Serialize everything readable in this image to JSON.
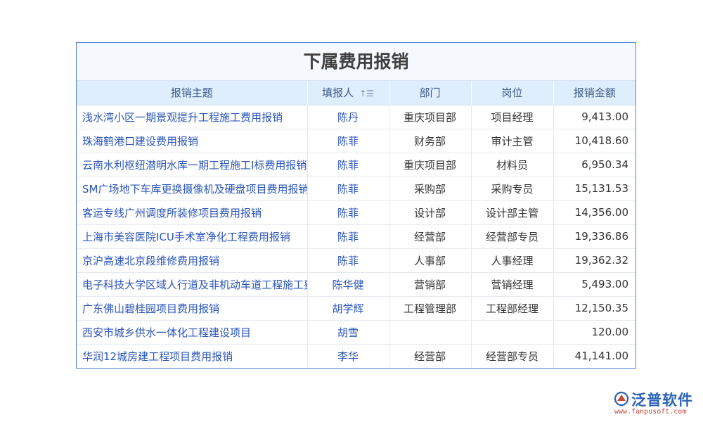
{
  "page_title": "下属费用报销",
  "columns": [
    {
      "label": "报销主题"
    },
    {
      "label": "填报人"
    },
    {
      "label": "部门"
    },
    {
      "label": "岗位"
    },
    {
      "label": "报销金额"
    }
  ],
  "sort_icon": "sort-ascending-icon",
  "rows": [
    {
      "subject": "浅水湾小区一期景观提升工程施工费用报销",
      "person": "陈丹",
      "dept": "重庆项目部",
      "position": "项目经理",
      "amount": "9,413.00"
    },
    {
      "subject": "珠海鹤港口建设费用报销",
      "person": "陈菲",
      "dept": "财务部",
      "position": "审计主管",
      "amount": "10,418.60"
    },
    {
      "subject": "云南水利枢纽潜明水库一期工程施工Ⅰ标费用报销",
      "person": "陈菲",
      "dept": "重庆项目部",
      "position": "材料员",
      "amount": "6,950.34"
    },
    {
      "subject": "SM广场地下车库更换摄像机及硬盘项目费用报销",
      "person": "陈菲",
      "dept": "采购部",
      "position": "采购专员",
      "amount": "15,131.53"
    },
    {
      "subject": "客运专线广州调度所装修项目费用报销",
      "person": "陈菲",
      "dept": "设计部",
      "position": "设计部主管",
      "amount": "14,356.00"
    },
    {
      "subject": "上海市美容医院ICU手术室净化工程费用报销",
      "person": "陈菲",
      "dept": "经营部",
      "position": "经营部专员",
      "amount": "19,336.86"
    },
    {
      "subject": "京沪高速北京段维修费用报销",
      "person": "陈菲",
      "dept": "人事部",
      "position": "人事经理",
      "amount": "19,362.32"
    },
    {
      "subject": "电子科技大学区域人行道及非机动车道工程施工费用报销",
      "person": "陈华健",
      "dept": "营销部",
      "position": "营销经理",
      "amount": "5,493.00"
    },
    {
      "subject": "广东佛山碧桂园项目费用报销",
      "person": "胡学辉",
      "dept": "工程管理部",
      "position": "工程部经理",
      "amount": "12,150.35"
    },
    {
      "subject": "西安市城乡供水一体化工程建设项目",
      "person": "胡雪",
      "dept": "",
      "position": "",
      "amount": "120.00"
    },
    {
      "subject": "华润12城房建工程项目费用报销",
      "person": "李华",
      "dept": "经营部",
      "position": "经营部专员",
      "amount": "41,141.00"
    }
  ],
  "logo": {
    "name": "泛普软件",
    "url": "www.fanpusoft.com",
    "colors": {
      "blue": "#2a62b8",
      "red": "#c8483a"
    }
  },
  "colors": {
    "header_bg": "#dfeefc",
    "border": "#4f7fd6",
    "link_text": "#2a55b8"
  }
}
